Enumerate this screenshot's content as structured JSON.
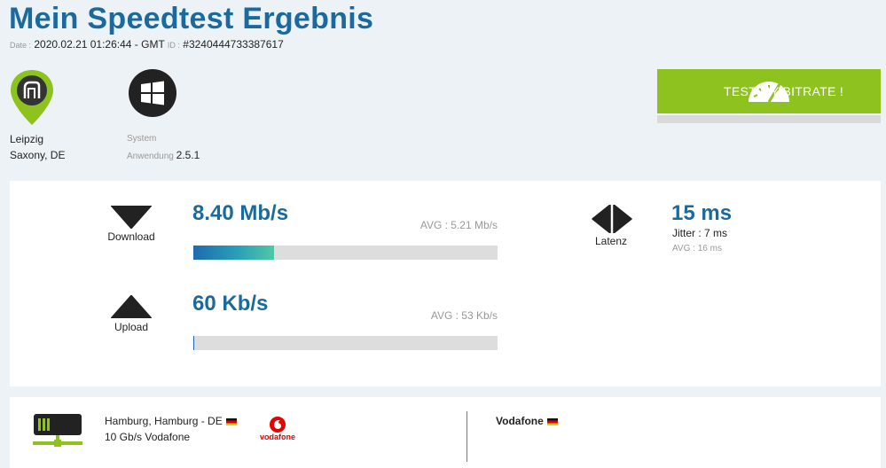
{
  "header": {
    "title": "Mein Speedtest Ergebnis",
    "date_label": "Date :",
    "date_value": "2020.02.21 01:26:44 - GMT",
    "id_label": "ID :",
    "id_value": "#3240444733387617"
  },
  "location": {
    "city": "Leipzig",
    "region": "Saxony, DE",
    "icon": "location-pin-icon"
  },
  "system": {
    "label": "System",
    "app_label": "Anwendung",
    "app_version": "2.5.1",
    "icon": "windows-logo-icon"
  },
  "test_button": {
    "label": "TEST MY BITRATE !",
    "color": "#8dc21f",
    "icon": "speedometer-icon"
  },
  "download": {
    "label": "Download",
    "value": "8.40 Mb/s",
    "avg": "AVG : 5.21 Mb/s",
    "fill_fraction": 0.265
  },
  "upload": {
    "label": "Upload",
    "value": "60 Kb/s",
    "avg": "AVG : 53 Kb/s",
    "fill_fraction": 0.004
  },
  "latency": {
    "label": "Latenz",
    "value": "15 ms",
    "jitter": "Jitter : 7 ms",
    "avg": "AVG : 16 ms"
  },
  "server": {
    "location": "Hamburg, Hamburg - DE",
    "speed_provider": "10 Gb/s Vodafone",
    "logo_text": "vodafone",
    "icon": "server-icon"
  },
  "isp": {
    "name": "Vodafone"
  },
  "colors": {
    "accent": "#1b6a9e",
    "green": "#8dc21f",
    "vodafone_red": "#e60000"
  }
}
